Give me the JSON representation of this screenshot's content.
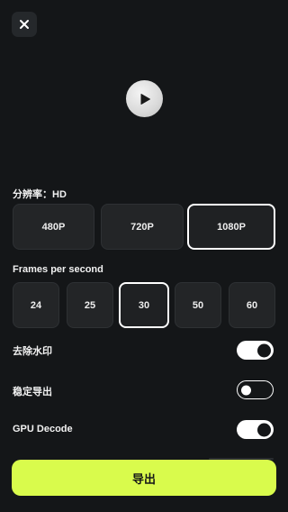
{
  "header": {
    "close_icon": "close-icon"
  },
  "preview": {
    "play_icon": "play-icon"
  },
  "resolution": {
    "label": "分辨率：HD",
    "options": [
      {
        "label": "480P",
        "selected": false
      },
      {
        "label": "720P",
        "selected": false
      },
      {
        "label": "1080P",
        "selected": true
      }
    ]
  },
  "fps": {
    "label": "Frames per second",
    "options": [
      {
        "label": "24",
        "selected": false
      },
      {
        "label": "25",
        "selected": false
      },
      {
        "label": "30",
        "selected": true
      },
      {
        "label": "50",
        "selected": false
      },
      {
        "label": "60",
        "selected": false
      }
    ]
  },
  "toggles": [
    {
      "label": "去除水印",
      "on": true
    },
    {
      "label": "稳定导出",
      "on": false
    },
    {
      "label": "GPU Decode",
      "on": true
    }
  ],
  "export": {
    "label": "导出"
  },
  "colors": {
    "background": "#141618",
    "accent": "#d9fb4c",
    "chip": "#232527",
    "selected_border": "#ffffff"
  }
}
